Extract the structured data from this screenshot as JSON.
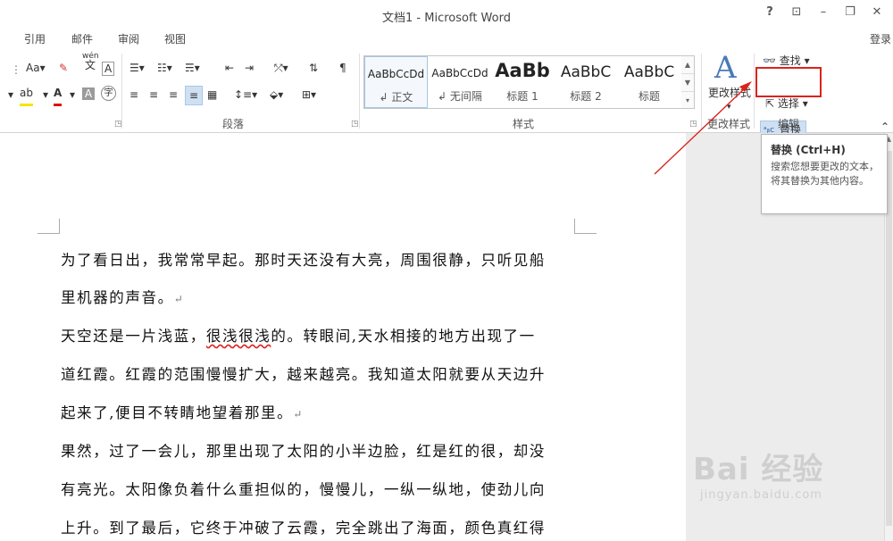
{
  "window": {
    "title": "文档1 - Microsoft Word",
    "help": "?",
    "ribbon_display": "⊡",
    "minimize": "–",
    "restore": "❐",
    "close": "✕"
  },
  "tabs": [
    "引用",
    "邮件",
    "审阅",
    "视图"
  ],
  "login": "登录",
  "font_group": {
    "size_label": "Aa",
    "phonetic": "wén",
    "phonetic_char": "文",
    "border_char": "A",
    "clear_char": "A",
    "circle_char": "字"
  },
  "paragraph_group": {
    "label": "段落"
  },
  "styles_group": {
    "label": "样式",
    "items": [
      {
        "preview": "AaBbCcDd",
        "name": "正文",
        "selected": true
      },
      {
        "preview": "AaBbCcDd",
        "name": "无间隔",
        "selected": false
      },
      {
        "preview": "AaBb",
        "name": "标题 1",
        "selected": false
      },
      {
        "preview": "AaBbC",
        "name": "标题 2",
        "selected": false
      },
      {
        "preview": "AaBbC",
        "name": "标题",
        "selected": false
      }
    ]
  },
  "change_styles": {
    "label": "更改样式",
    "group_label": "更改样式"
  },
  "editing_group": {
    "label": "编辑",
    "find": "查找",
    "replace": "替换",
    "select": "选择"
  },
  "tooltip": {
    "title": "替换 (Ctrl+H)",
    "desc": "搜索您想要更改的文本，将其替换为其他内容。"
  },
  "document": {
    "lines": [
      "为了看日出，我常常早起。那时天还没有大亮，周围很静，只听见船",
      "里机器的声音。",
      "天空还是一片浅蓝，",
      "很浅很浅",
      "的。转眼间,天水相接的地方出现了一",
      "道红霞。红霞的范围慢慢扩大，越来越亮。我知道太阳就要从天边升",
      "起来了,便目不转睛地望着那里。",
      "果然，过了一会儿，那里出现了太阳的小半边脸，红是红的很，却没",
      "有亮光。太阳像负着什么重担似的，慢慢儿，一纵一纵地，使劲儿向",
      "上升。到了最后，它终于冲破了云霞，完全跳出了海面，颜色真红得"
    ],
    "para_mark": "↵"
  },
  "watermark": {
    "brand": "Bai 经验",
    "url": "jingyan.baidu.com"
  },
  "colors": {
    "highlight_red": "#d9241c",
    "selected_blue": "#cfe0f3"
  }
}
